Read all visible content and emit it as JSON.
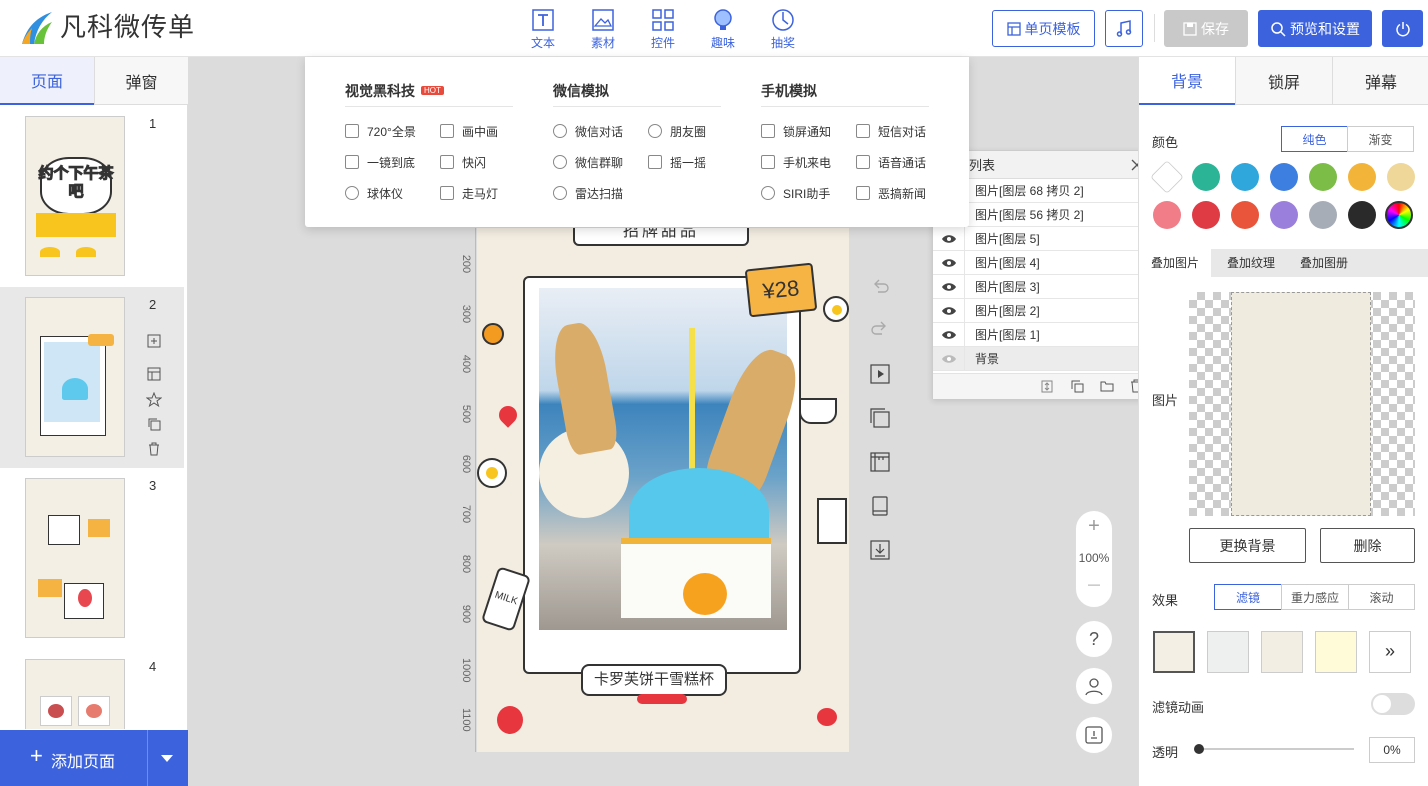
{
  "app": {
    "logo_text": "凡科微传单"
  },
  "toolbar": {
    "tools": [
      {
        "label": "文本",
        "icon": "text-icon"
      },
      {
        "label": "素材",
        "icon": "image-icon"
      },
      {
        "label": "控件",
        "icon": "widgets-icon"
      },
      {
        "label": "趣味",
        "icon": "bulb-icon"
      },
      {
        "label": "抽奖",
        "icon": "lottery-icon"
      }
    ],
    "single_template": "单页模板",
    "save": "保存",
    "preview": "预览和设置"
  },
  "left": {
    "tabs": [
      "页面",
      "弹窗"
    ],
    "pages": [
      "1",
      "2",
      "3",
      "4"
    ],
    "thumb1_title": "约个下午茶吧",
    "add_page": "添加页面"
  },
  "dropdown": {
    "col1": {
      "title": "视觉黑科技",
      "badge": "HOT",
      "items": [
        "720°全景",
        "画中画",
        "一镜到底",
        "快闪",
        "球体仪",
        "走马灯"
      ]
    },
    "col2": {
      "title": "微信模拟",
      "items": [
        "微信对话",
        "朋友圈",
        "微信群聊",
        "摇一摇",
        "雷达扫描"
      ]
    },
    "col3": {
      "title": "手机模拟",
      "items": [
        "锁屏通知",
        "短信对话",
        "手机来电",
        "语音通话",
        "SIRI助手",
        "恶搞新闻"
      ]
    }
  },
  "ruler": [
    "200",
    "300",
    "400",
    "500",
    "600",
    "700",
    "800",
    "900",
    "1000",
    "1100"
  ],
  "phone": {
    "header": "招牌甜品",
    "price": "¥28",
    "caption": "卡罗芙饼干雪糕杯",
    "milk": "MILK"
  },
  "layers": {
    "title": "列表",
    "rows": [
      "图片[图层 68 拷贝 2]",
      "图片[图层 56 拷贝 2]",
      "图片[图层 5]",
      "图片[图层 4]",
      "图片[图层 3]",
      "图片[图层 2]",
      "图片[图层 1]",
      "背景"
    ]
  },
  "zoom": {
    "plus": "+",
    "value": "100%",
    "minus": "—"
  },
  "help": "?",
  "right": {
    "tabs": [
      "背景",
      "锁屏",
      "弹幕"
    ],
    "color_label": "颜色",
    "color_modes": [
      "纯色",
      "渐变"
    ],
    "swatches": [
      "#ffffff",
      "#2bb596",
      "#2fa7dc",
      "#3d7fe0",
      "#7cbd48",
      "#f3b43a",
      "#efd79a",
      "#f07d88",
      "#de3b45",
      "#e9553b",
      "#9a7fdc",
      "#a7adb7",
      "#2a2a2a"
    ],
    "overlay_tabs": [
      "叠加图片",
      "叠加纹理",
      "叠加图册"
    ],
    "image_label": "图片",
    "replace_bg": "更换背景",
    "delete": "删除",
    "effect_label": "效果",
    "effects": [
      "滤镜",
      "重力感应",
      "滚动"
    ],
    "more": "»",
    "filter_anim": "滤镜动画",
    "opacity_label": "透明",
    "opacity_value": "0%"
  }
}
